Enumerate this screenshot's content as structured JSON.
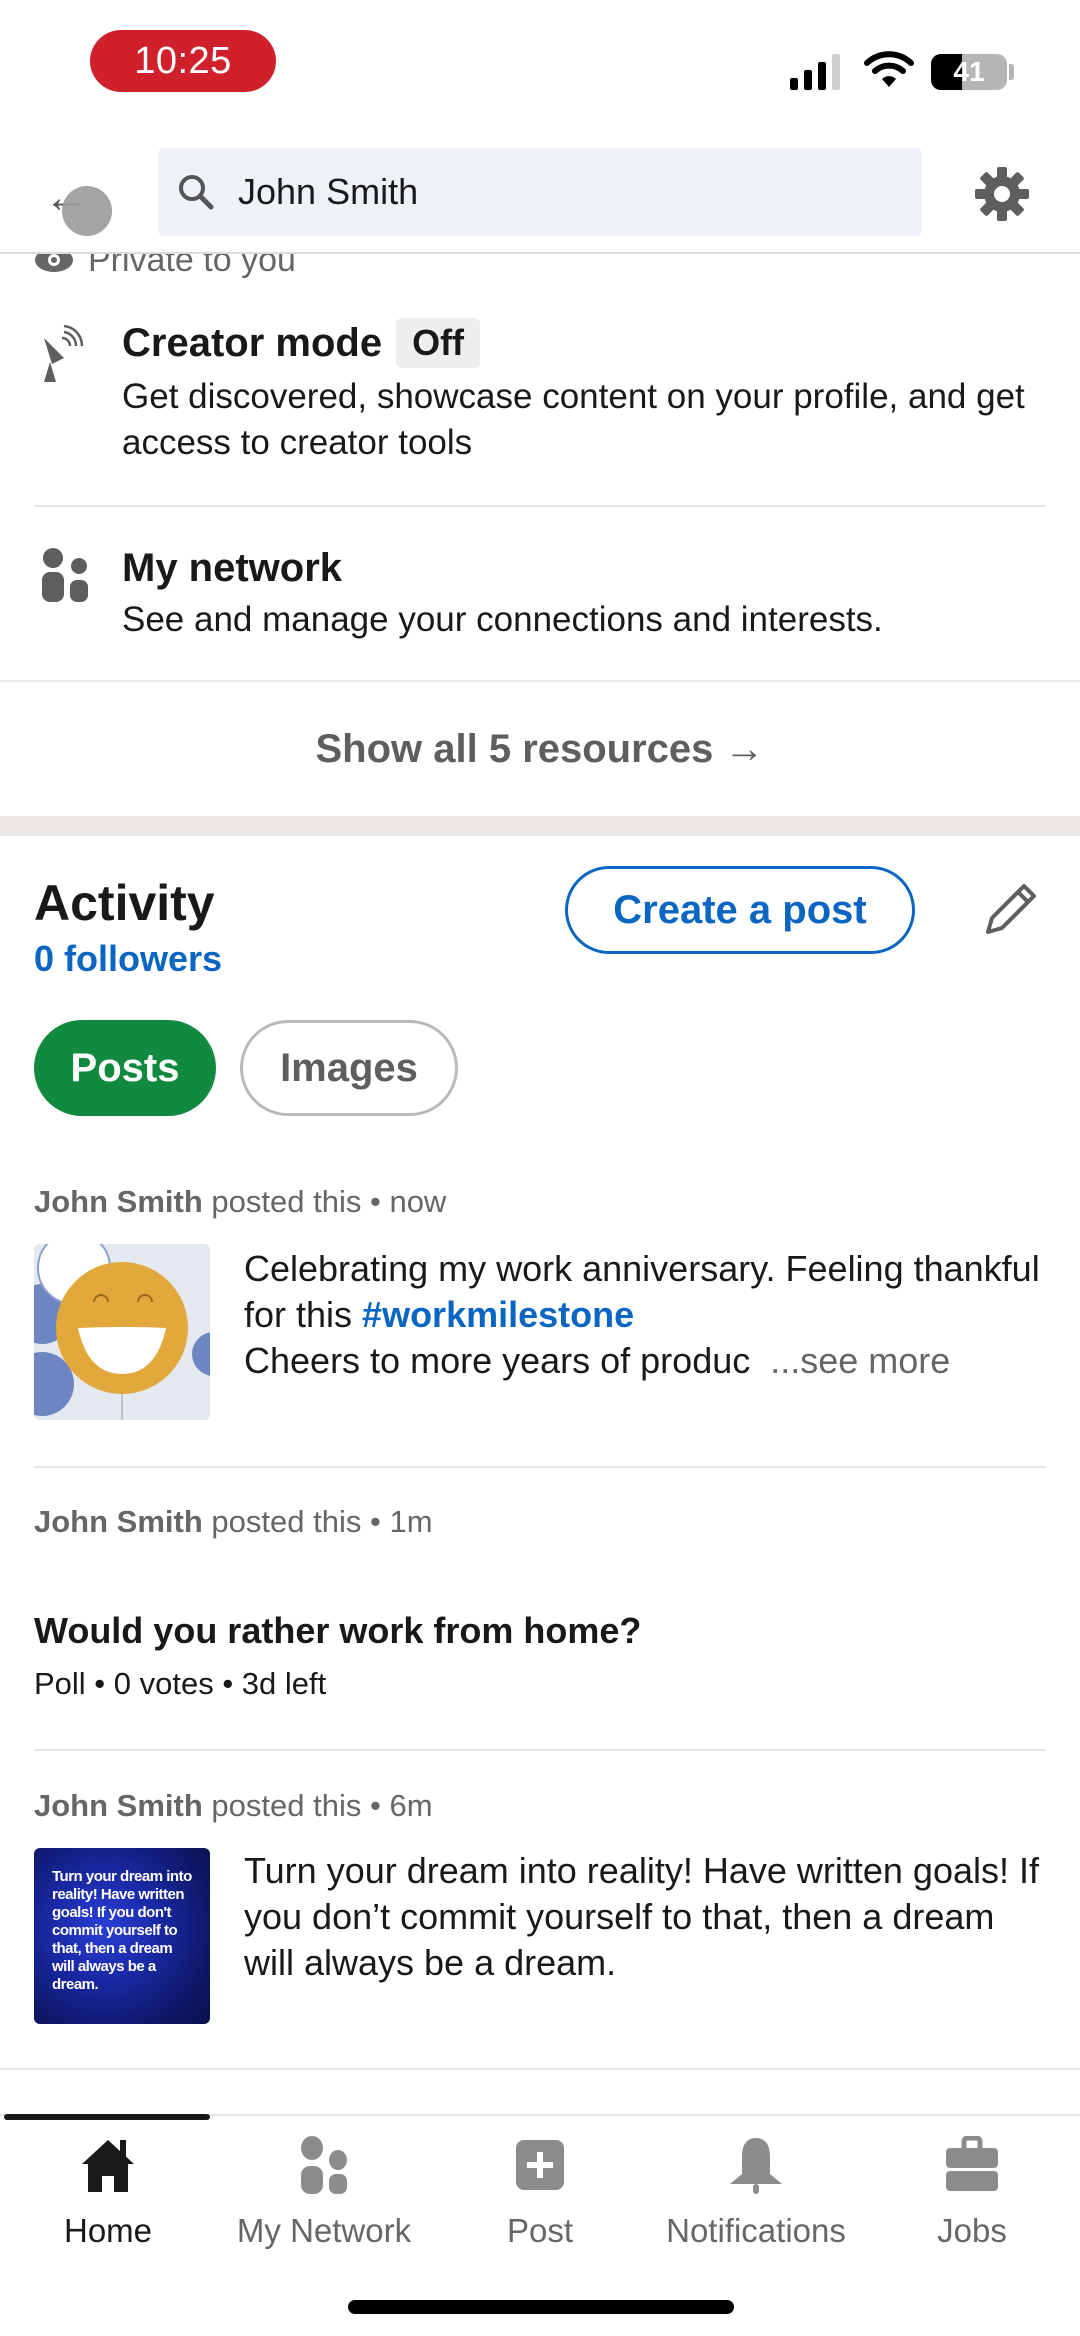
{
  "status_bar": {
    "time": "10:25",
    "battery_percent": "41",
    "battery_level": 0.41,
    "signal_bars": 3,
    "signal_max": 4
  },
  "top_nav": {
    "back_icon": "back-arrow-icon",
    "search_icon": "search-icon",
    "search_value": "John Smith",
    "settings_icon": "gear-icon"
  },
  "resources": {
    "private_label": "Private to you",
    "items": [
      {
        "icon": "creator-mode-icon",
        "title": "Creator mode",
        "badge": "Off",
        "description": "Get discovered, showcase content on your profile, and get access to creator tools"
      },
      {
        "icon": "my-network-icon",
        "title": "My network",
        "description": "See and manage your connections and interests."
      }
    ],
    "show_all_label": "Show all 5 resources →"
  },
  "activity": {
    "title": "Activity",
    "followers": "0 followers",
    "create_post_label": "Create a post",
    "edit_icon": "pencil-icon",
    "filters": [
      {
        "label": "Posts",
        "selected": true
      },
      {
        "label": "Images",
        "selected": false
      }
    ],
    "posts": [
      {
        "author": "John Smith",
        "action": "posted this",
        "time": "now",
        "text_before": "Celebrating my work anniversary. Feeling thankful for this ",
        "hashtag": "#workmilestone",
        "text_after": "Cheers to more years of produc",
        "see_more": "...see more",
        "thumbnail": "smiley-balloon-image"
      },
      {
        "author": "John Smith",
        "action": "posted this",
        "time": "1m",
        "poll_question": "Would you rather work from home?",
        "poll_info": "Poll • 0 votes • 3d left"
      },
      {
        "author": "John Smith",
        "action": "posted this",
        "time": "6m",
        "text": "Turn your dream into reality! Have written goals! If you don’t commit yourself to that, then a dream will always be a dream.",
        "thumbnail_text": "Turn your dream into reality! Have written goals! If you don't commit yourself to that, then a dream will always be a dream."
      }
    ]
  },
  "bottom_nav": {
    "items": [
      {
        "label": "Home",
        "icon": "home-icon",
        "active": true
      },
      {
        "label": "My Network",
        "icon": "my-network-icon",
        "active": false
      },
      {
        "label": "Post",
        "icon": "post-plus-icon",
        "active": false
      },
      {
        "label": "Notifications",
        "icon": "bell-icon",
        "active": false
      },
      {
        "label": "Jobs",
        "icon": "briefcase-icon",
        "active": false
      }
    ]
  },
  "colors": {
    "accent_blue": "#0a66c2",
    "posts_chip_green": "#118a3f",
    "time_pill_red": "#d0202c"
  }
}
